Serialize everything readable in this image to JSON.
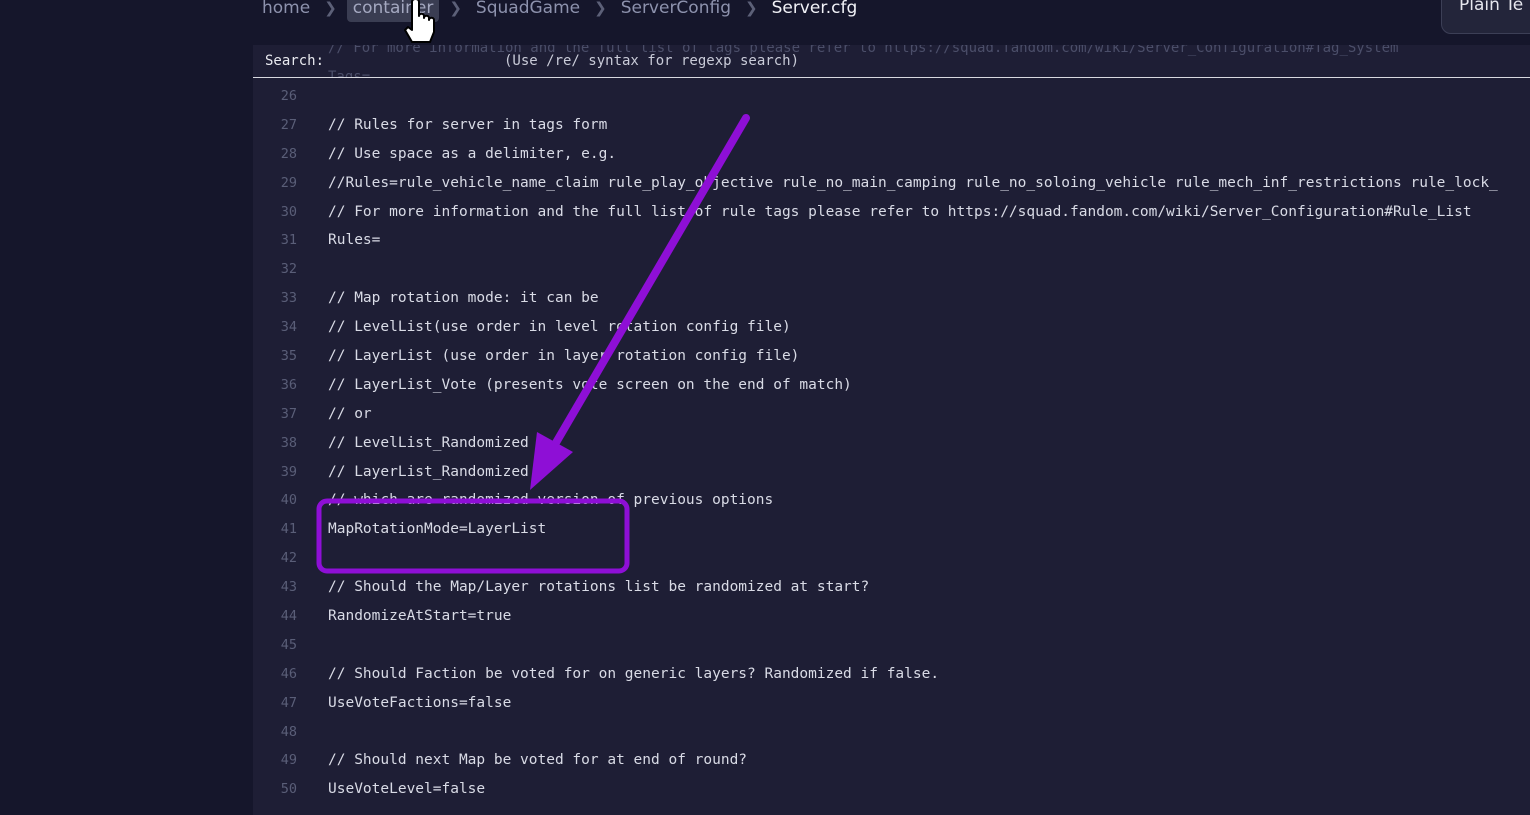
{
  "breadcrumb": {
    "items": [
      "home",
      "container",
      "SquadGame",
      "ServerConfig",
      "Server.cfg"
    ]
  },
  "mode_pill": {
    "label": "Plain Te"
  },
  "search": {
    "label": "Search:",
    "hint": "(Use /re/ syntax for regexp search)",
    "ghost_top": "// For more information and the full list of tags please refer to https://squad.fandom.com/wiki/Server_Configuration#Tag_System",
    "ghost_bottom": "Tags="
  },
  "editor": {
    "lines": [
      {
        "n": "26",
        "text": ""
      },
      {
        "n": "27",
        "text": "// Rules for server in tags form"
      },
      {
        "n": "28",
        "text": "// Use space as a delimiter, e.g."
      },
      {
        "n": "29",
        "text": "//Rules=rule_vehicle_name_claim rule_play_objective rule_no_main_camping rule_no_soloing_vehicle rule_mech_inf_restrictions rule_lock_"
      },
      {
        "n": "30",
        "text": "// For more information and the full list of rule tags please refer to https://squad.fandom.com/wiki/Server_Configuration#Rule_List"
      },
      {
        "n": "31",
        "text": "Rules="
      },
      {
        "n": "32",
        "text": ""
      },
      {
        "n": "33",
        "text": "// Map rotation mode: it can be"
      },
      {
        "n": "34",
        "text": "// LevelList(use order in level rotation config file)"
      },
      {
        "n": "35",
        "text": "// LayerList (use order in layer rotation config file)"
      },
      {
        "n": "36",
        "text": "// LayerList_Vote (presents vote screen on the end of match)"
      },
      {
        "n": "37",
        "text": "// or"
      },
      {
        "n": "38",
        "text": "// LevelList_Randomized"
      },
      {
        "n": "39",
        "text": "// LayerList_Randomized"
      },
      {
        "n": "40",
        "text": "// which are randomized version of previous options"
      },
      {
        "n": "41",
        "text": "MapRotationMode=LayerList"
      },
      {
        "n": "42",
        "text": ""
      },
      {
        "n": "43",
        "text": "// Should the Map/Layer rotations list be randomized at start?"
      },
      {
        "n": "44",
        "text": "RandomizeAtStart=true"
      },
      {
        "n": "45",
        "text": ""
      },
      {
        "n": "46",
        "text": "// Should Faction be voted for on generic layers? Randomized if false."
      },
      {
        "n": "47",
        "text": "UseVoteFactions=false"
      },
      {
        "n": "48",
        "text": ""
      },
      {
        "n": "49",
        "text": "// Should next Map be voted for at end of round?"
      },
      {
        "n": "50",
        "text": "UseVoteLevel=false"
      }
    ]
  },
  "annotation": {
    "color": "#8e0fd6"
  }
}
